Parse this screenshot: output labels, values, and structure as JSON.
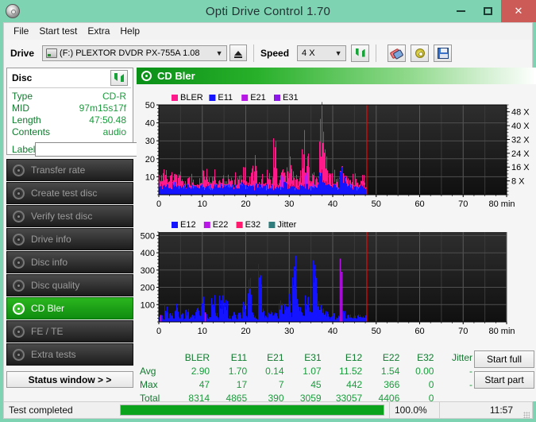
{
  "window": {
    "title": "Opti Drive Control 1.70",
    "icon": "disc-icon",
    "controls": {
      "minimize": "–",
      "maximize": "□",
      "close": "✕"
    }
  },
  "menu": {
    "items": [
      "File",
      "Start test",
      "Extra",
      "Help"
    ]
  },
  "toolbar": {
    "drive_label": "Drive",
    "drive_value": "(F:)  PLEXTOR DVDR  PX-755A 1.08",
    "eject_title": "Eject",
    "speed_label": "Speed",
    "speed_value": "4 X",
    "icons": [
      "refresh-icon",
      "eraser-icon",
      "gear-icon",
      "save-icon"
    ]
  },
  "disc": {
    "title": "Disc",
    "refresh_icon": "refresh-icon",
    "rows": [
      {
        "key": "Type",
        "value": "CD-R"
      },
      {
        "key": "MID",
        "value": "97m15s17f"
      },
      {
        "key": "Length",
        "value": "47:50.48"
      },
      {
        "key": "Contents",
        "value": "audio"
      }
    ],
    "label_key": "Label",
    "label_value": "",
    "label_placeholder": ""
  },
  "nav": {
    "items": [
      {
        "label": "Transfer rate",
        "active": false
      },
      {
        "label": "Create test disc",
        "active": false
      },
      {
        "label": "Verify test disc",
        "active": false
      },
      {
        "label": "Drive info",
        "active": false
      },
      {
        "label": "Disc info",
        "active": false
      },
      {
        "label": "Disc quality",
        "active": false
      },
      {
        "label": "CD Bler",
        "active": true
      },
      {
        "label": "FE / TE",
        "active": false
      },
      {
        "label": "Extra tests",
        "active": false
      }
    ],
    "status_button": "Status window > >"
  },
  "panel": {
    "title": "CD Bler",
    "icon": "disc-icon"
  },
  "actions": {
    "start_full": "Start full",
    "start_part": "Start part"
  },
  "statusbar": {
    "text": "Test completed",
    "percent_label": "100.0%",
    "percent_value": 100,
    "time": "11:57"
  },
  "stats": {
    "columns": [
      "BLER",
      "E11",
      "E21",
      "E31",
      "E12",
      "E22",
      "E32",
      "Jitter"
    ],
    "rows": [
      {
        "label": "Avg",
        "values": [
          "2.90",
          "1.70",
          "0.14",
          "1.07",
          "11.52",
          "1.54",
          "0.00",
          "-"
        ]
      },
      {
        "label": "Max",
        "values": [
          "47",
          "17",
          "7",
          "45",
          "442",
          "366",
          "0",
          "-"
        ]
      },
      {
        "label": "Total",
        "values": [
          "8314",
          "4865",
          "390",
          "3059",
          "33057",
          "4406",
          "0",
          ""
        ]
      }
    ]
  },
  "colors": {
    "bler": "#ff1a8c",
    "e11": "#1414ff",
    "e21": "#b817e8",
    "e31": "#8c18e8",
    "e12": "#1414ff",
    "e22": "#b817e8",
    "e32": "#ff1a6e",
    "jitter": "#2f7d7d",
    "plot_bg": "#1c1c1c",
    "marker_line": "#ff0000",
    "header_green": "#0a8f17",
    "value_green": "#1a9c3c"
  },
  "chart_data": [
    {
      "type": "line",
      "name": "CD Bler (error rates)",
      "title": "CD Bler",
      "xlabel": "min",
      "ylabel": "",
      "xlim": [
        0,
        80
      ],
      "ylim": [
        0,
        50
      ],
      "xticks": [
        0,
        10,
        20,
        30,
        40,
        50,
        60,
        70,
        80
      ],
      "yticks": [
        10,
        20,
        30,
        40,
        50
      ],
      "y2label": "X",
      "y2ticks": [
        "8 X",
        "16 X",
        "24 X",
        "32 X",
        "40 X",
        "48 X"
      ],
      "y2lim": [
        0,
        52
      ],
      "grid": true,
      "legend": [
        "BLER",
        "E11",
        "E21",
        "E31"
      ],
      "legend_position": "top-left",
      "data_end_min": 47.84,
      "marker_line_x": 47.84,
      "series": [
        {
          "name": "BLER",
          "color": "#ff1a8c",
          "x": [
            0.3,
            0.8,
            1.2,
            1.7,
            2.2,
            2.7,
            3.2,
            3.7,
            4.2,
            4.7,
            5.2,
            5.7,
            6.2,
            6.7,
            7.2,
            7.7,
            8.2,
            8.7,
            9.2,
            9.7,
            10.2,
            10.7,
            11.2,
            11.7,
            12.2,
            12.7,
            13.2,
            13.7,
            14.2,
            14.7,
            15.2,
            15.7,
            16.2,
            16.7,
            17.2,
            17.7,
            18.2,
            18.7,
            19.2,
            19.7,
            20.2,
            20.7,
            21.2,
            21.7,
            22.2,
            22.7,
            23.2,
            23.7,
            24.2,
            24.7,
            25.2,
            25.7,
            26.2,
            26.7,
            27.2,
            27.7,
            28.2,
            28.7,
            29.2,
            29.7,
            30.2,
            30.7,
            31.2,
            31.7,
            32.2,
            32.7,
            33.2,
            33.7,
            34.2,
            34.7,
            35.2,
            35.7,
            36.2,
            36.7,
            37.2,
            37.7,
            38.2,
            38.7,
            39.2,
            39.7,
            40.2,
            40.7,
            41.2,
            41.7,
            42.2,
            42.7,
            43.2,
            43.7,
            44.2,
            44.7,
            45.2,
            45.7,
            46.2,
            46.7,
            47.2,
            47.8
          ],
          "y": [
            12,
            9,
            15,
            6,
            11,
            14,
            5,
            13,
            9,
            15,
            7,
            12,
            4,
            10,
            6,
            13,
            8,
            5,
            11,
            7,
            14,
            16,
            6,
            9,
            12,
            16,
            5,
            10,
            7,
            11,
            9,
            6,
            13,
            8,
            5,
            12,
            7,
            10,
            4,
            14,
            9,
            6,
            12,
            21,
            8,
            16,
            5,
            11,
            9,
            7,
            13,
            6,
            10,
            31,
            8,
            12,
            5,
            14,
            7,
            22,
            9,
            16,
            6,
            11,
            13,
            7,
            34,
            10,
            21,
            8,
            15,
            6,
            12,
            9,
            47,
            43,
            27,
            14,
            8,
            11,
            6,
            13,
            9,
            7,
            12,
            5,
            10,
            8,
            6,
            11,
            7,
            9,
            5,
            12,
            8,
            6
          ]
        },
        {
          "name": "E11",
          "color": "#1414ff",
          "x": [
            0.3,
            1.0,
            1.8,
            2.6,
            3.4,
            4.2,
            5.0,
            5.8,
            6.6,
            7.4,
            8.2,
            9.0,
            9.8,
            10.6,
            11.4,
            12.2,
            13.0,
            13.8,
            14.6,
            15.4,
            16.2,
            17.0,
            17.8,
            18.6,
            19.4,
            20.2,
            21.0,
            21.8,
            22.6,
            23.4,
            24.2,
            25.0,
            25.8,
            26.6,
            27.4,
            28.2,
            29.0,
            29.8,
            30.6,
            31.4,
            32.2,
            33.0,
            33.8,
            34.6,
            35.4,
            36.2,
            37.0,
            37.8,
            38.6,
            39.4,
            40.2,
            41.0,
            41.8,
            42.6,
            43.4,
            44.2,
            45.0,
            45.8,
            46.6,
            47.4
          ],
          "y": [
            5,
            4,
            6,
            3,
            7,
            4,
            5,
            3,
            6,
            4,
            5,
            3,
            7,
            4,
            5,
            3,
            6,
            4,
            5,
            3,
            6,
            4,
            5,
            3,
            7,
            4,
            5,
            3,
            6,
            4,
            5,
            3,
            6,
            4,
            5,
            3,
            7,
            4,
            6,
            3,
            5,
            4,
            6,
            3,
            5,
            4,
            17,
            12,
            8,
            5,
            7,
            4,
            15,
            10,
            6,
            4,
            5,
            3,
            6,
            4
          ]
        }
      ]
    },
    {
      "type": "line",
      "name": "CD Bler (burst errors)",
      "xlabel": "min",
      "ylabel": "",
      "xlim": [
        0,
        80
      ],
      "ylim": [
        0,
        520
      ],
      "xticks": [
        0,
        10,
        20,
        30,
        40,
        50,
        60,
        70,
        80
      ],
      "yticks": [
        100,
        200,
        300,
        400,
        500
      ],
      "grid": true,
      "legend": [
        "E12",
        "E22",
        "E32",
        "Jitter"
      ],
      "legend_position": "top-left",
      "data_end_min": 47.84,
      "marker_line_x": 47.84,
      "series": [
        {
          "name": "E12",
          "color": "#1414ff",
          "x": [
            0.3,
            1.0,
            1.6,
            2.2,
            2.8,
            3.4,
            4.0,
            4.6,
            5.2,
            5.8,
            6.4,
            7.0,
            7.6,
            8.2,
            8.8,
            9.4,
            10.0,
            10.6,
            11.2,
            11.8,
            12.4,
            13.0,
            13.6,
            14.2,
            14.8,
            15.4,
            16.0,
            16.6,
            17.2,
            17.8,
            18.4,
            19.0,
            19.6,
            20.2,
            20.8,
            21.4,
            22.0,
            22.6,
            23.2,
            23.8,
            24.4,
            25.0,
            25.6,
            26.2,
            26.8,
            27.4,
            28.0,
            28.6,
            29.2,
            29.8,
            30.4,
            31.0,
            31.6,
            32.2,
            32.8,
            33.4,
            34.0,
            34.6,
            35.2,
            35.8,
            36.4,
            37.0,
            37.6,
            38.2,
            38.8,
            39.4,
            40.0,
            40.6,
            41.2,
            41.8,
            42.4,
            43.0,
            43.6,
            44.2,
            44.8,
            45.4,
            46.0,
            46.6,
            47.2,
            47.8
          ],
          "y": [
            45,
            20,
            96,
            30,
            55,
            25,
            95,
            35,
            60,
            20,
            70,
            28,
            45,
            22,
            85,
            40,
            150,
            60,
            35,
            25,
            170,
            50,
            30,
            140,
            45,
            120,
            35,
            20,
            60,
            25,
            55,
            30,
            110,
            40,
            240,
            60,
            35,
            25,
            412,
            70,
            40,
            30,
            65,
            38,
            55,
            25,
            120,
            45,
            135,
            150,
            50,
            402,
            190,
            90,
            60,
            40,
            140,
            80,
            60,
            330,
            170,
            120,
            80,
            60,
            55,
            30,
            50,
            25,
            40,
            20,
            60,
            30,
            45,
            25,
            35,
            20,
            50,
            28,
            40,
            22
          ]
        },
        {
          "name": "E22",
          "color": "#b817e8",
          "x": [
            0.4,
            10.6,
            41.6,
            42.0
          ],
          "y": [
            40,
            55,
            366,
            290
          ]
        }
      ]
    }
  ]
}
